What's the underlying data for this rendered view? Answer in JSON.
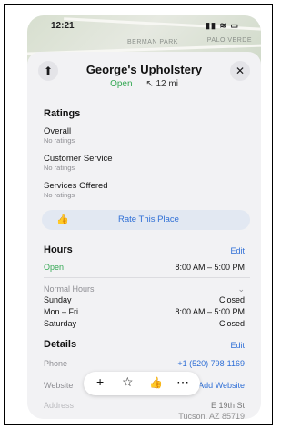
{
  "status_bar": {
    "time": "12:21",
    "icons": "▮▮ ≋ ▭"
  },
  "map": {
    "labels": [
      "PALO VERDE",
      "BERMAN PARK"
    ]
  },
  "header": {
    "share_icon": "⬆",
    "title": "George's Upholstery",
    "status": "Open",
    "distance": "12 mi",
    "close_icon": "✕"
  },
  "ratings": {
    "heading": "Ratings",
    "items": [
      {
        "label": "Overall",
        "value": "No ratings"
      },
      {
        "label": "Customer Service",
        "value": "No ratings"
      },
      {
        "label": "Services Offered",
        "value": "No ratings"
      }
    ],
    "rate_button": "Rate This Place"
  },
  "hours": {
    "heading": "Hours",
    "edit": "Edit",
    "status": "Open",
    "today_hours": "8:00 AM – 5:00 PM",
    "normal_hours_label": "Normal Hours",
    "days": [
      {
        "day": "Sunday",
        "hours": "Closed"
      },
      {
        "day": "Mon – Fri",
        "hours": "8:00 AM – 5:00 PM"
      },
      {
        "day": "Saturday",
        "hours": "Closed"
      }
    ]
  },
  "details": {
    "heading": "Details",
    "edit": "Edit",
    "phone_label": "Phone",
    "phone": "+1 (520) 798-1169",
    "website_label": "Website",
    "add_website": "Add Website",
    "address_label": "Address",
    "address_line1": "E 19th St",
    "address_line2": "Tucson, AZ 85719"
  },
  "toolbar": {
    "add": "+",
    "favorite": "☆",
    "thumbs": "👍",
    "more": "⋯"
  }
}
